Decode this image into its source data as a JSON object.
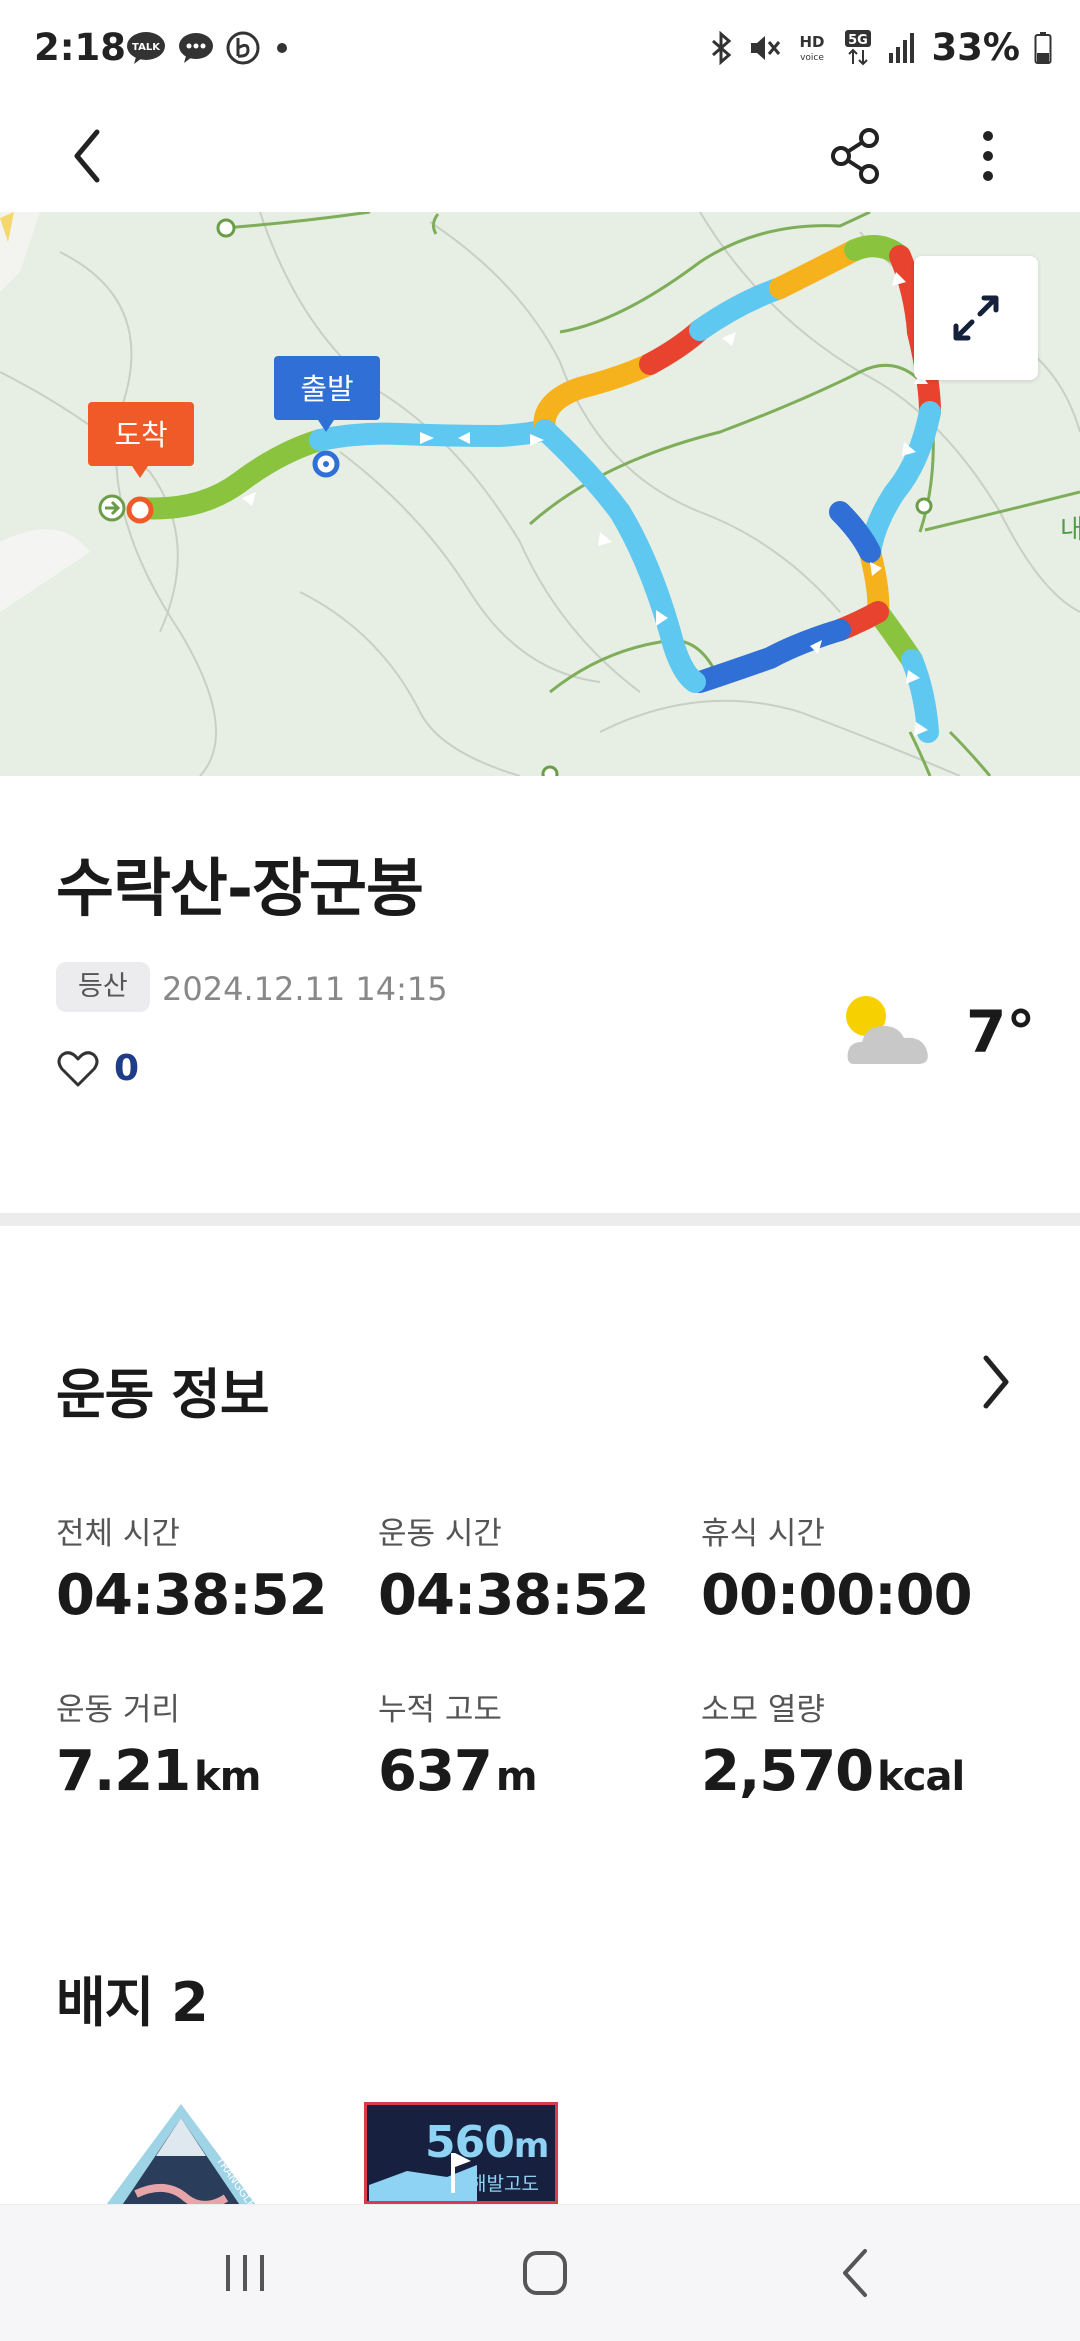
{
  "status_bar": {
    "time": "2:18",
    "battery": "33%",
    "icons": [
      "kakaotalk-icon",
      "chat-icon",
      "b-app-icon",
      "dot-icon",
      "bluetooth-icon",
      "mute-icon",
      "hd-voice-icon",
      "5g-icon",
      "signal-icon",
      "battery-icon"
    ]
  },
  "app_bar": {
    "back_icon": "chevron-left-icon",
    "share_icon": "share-icon",
    "more_icon": "more-vertical-icon"
  },
  "map": {
    "start_label": "출발",
    "end_label": "도착",
    "expand_icon": "expand-icon",
    "edge_label": "내",
    "colors": {
      "start": "#2f6fd6",
      "end": "#f05a28"
    }
  },
  "activity": {
    "title": "수락산-장군봉",
    "category": "등산",
    "datetime": "2024.12.11 14:15",
    "likes": "0",
    "weather_icon": "partly-cloudy-icon",
    "temperature": "7°"
  },
  "exercise_info": {
    "title": "운동 정보",
    "stats": [
      {
        "label": "전체 시간",
        "value": "04:38:52",
        "unit": ""
      },
      {
        "label": "운동 시간",
        "value": "04:38:52",
        "unit": ""
      },
      {
        "label": "휴식 시간",
        "value": "00:00:00",
        "unit": ""
      },
      {
        "label": "운동 거리",
        "value": "7.21",
        "unit": "km"
      },
      {
        "label": "누적 고도",
        "value": "637",
        "unit": "m"
      },
      {
        "label": "소모 열량",
        "value": "2,570",
        "unit": "kcal"
      }
    ]
  },
  "badges": {
    "title": "배지 2",
    "items": [
      {
        "name": "trangle-badge",
        "text": "TRANGGLE"
      },
      {
        "name": "altitude-badge",
        "value": "560",
        "unit": "m",
        "caption": "해발고도"
      }
    ]
  },
  "nav_bar": {
    "recent_icon": "recent-apps-icon",
    "home_icon": "home-icon",
    "back_icon": "back-icon"
  }
}
